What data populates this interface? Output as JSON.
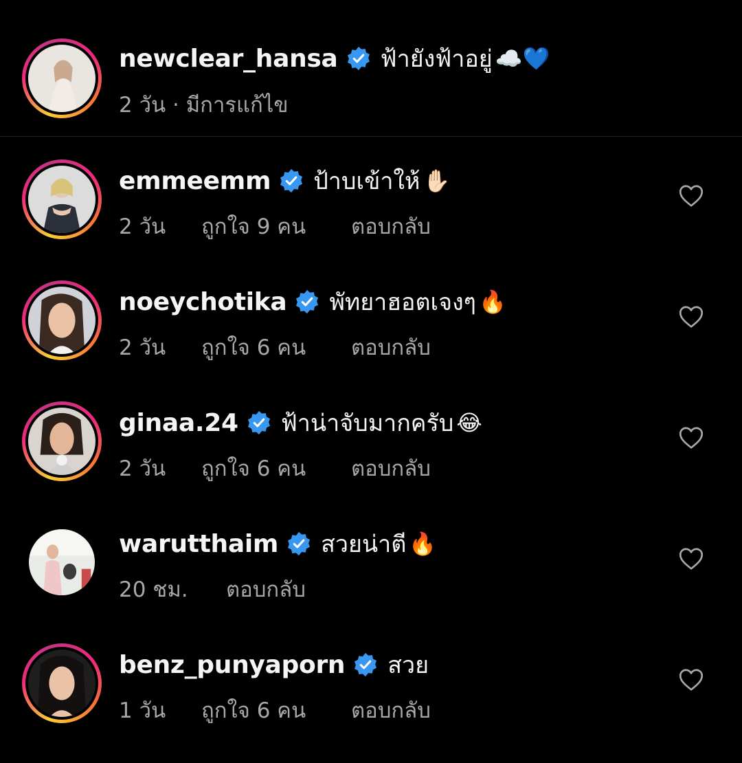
{
  "caption": {
    "username": "newclear_hansa",
    "text": "ฟ้ายังฟ้าอยู่",
    "emoji": "☁️💙",
    "meta": "2 วัน · มีการแก้ไข"
  },
  "comments": [
    {
      "username": "emmeemm",
      "text": "ป้าบเข้าให้",
      "emoji": "✋🏻",
      "time": "2 วัน",
      "likes": "ถูกใจ 9 คน",
      "reply": "ตอบกลับ"
    },
    {
      "username": "noeychotika",
      "text": "พัทยาฮอตเจงๆ",
      "emoji": "🔥",
      "time": "2 วัน",
      "likes": "ถูกใจ 6 คน",
      "reply": "ตอบกลับ"
    },
    {
      "username": "ginaa.24",
      "text": "ฟ้าน่าจับมากครับ",
      "emoji": "😂",
      "time": "2 วัน",
      "likes": "ถูกใจ 6 คน",
      "reply": "ตอบกลับ"
    },
    {
      "username": "warutthaim",
      "text": "สวยน่าตี",
      "emoji": "🔥",
      "time": "20 ชม.",
      "likes": "",
      "reply": "ตอบกลับ"
    },
    {
      "username": "benz_punyaporn",
      "text": "สวย",
      "emoji": "",
      "time": "1 วัน",
      "likes": "ถูกใจ 6 คน",
      "reply": "ตอบกลับ"
    }
  ],
  "icons": {
    "verified": "verified-badge-icon",
    "like": "heart-outline-icon"
  },
  "colors": {
    "background": "#000000",
    "text_primary": "#f5f5f5",
    "text_secondary": "#a8a8a8",
    "verified_blue": "#3897f0"
  }
}
